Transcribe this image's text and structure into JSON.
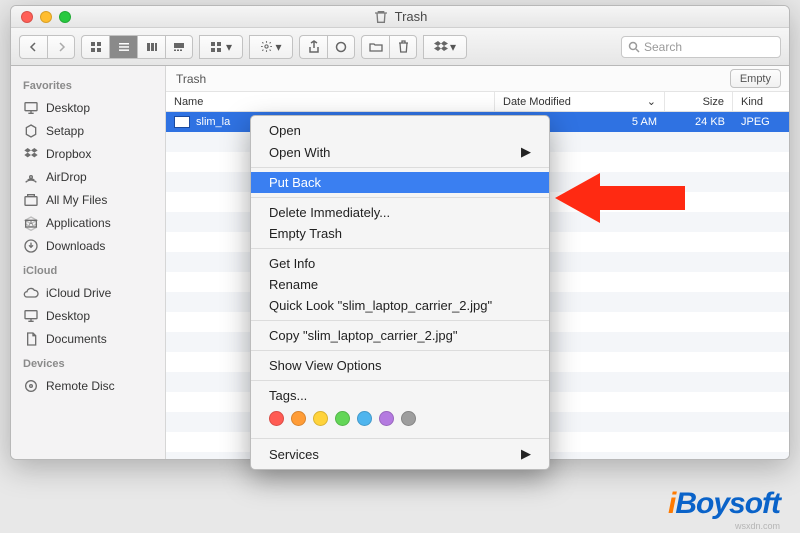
{
  "window": {
    "title": "Trash"
  },
  "toolbar": {
    "search_placeholder": "Search",
    "empty_label": "Empty"
  },
  "pathbar": {
    "location": "Trash"
  },
  "sidebar": {
    "sections": [
      {
        "title": "Favorites",
        "items": [
          {
            "label": "Desktop",
            "icon": "desktop"
          },
          {
            "label": "Setapp",
            "icon": "setapp"
          },
          {
            "label": "Dropbox",
            "icon": "dropbox"
          },
          {
            "label": "AirDrop",
            "icon": "airdrop"
          },
          {
            "label": "All My Files",
            "icon": "allfiles"
          },
          {
            "label": "Applications",
            "icon": "apps"
          },
          {
            "label": "Downloads",
            "icon": "downloads"
          }
        ]
      },
      {
        "title": "iCloud",
        "items": [
          {
            "label": "iCloud Drive",
            "icon": "icloud"
          },
          {
            "label": "Desktop",
            "icon": "desktop"
          },
          {
            "label": "Documents",
            "icon": "documents"
          }
        ]
      },
      {
        "title": "Devices",
        "items": [
          {
            "label": "Remote Disc",
            "icon": "disc"
          }
        ]
      }
    ]
  },
  "columns": {
    "name": "Name",
    "date": "Date Modified",
    "size": "Size",
    "kind": "Kind"
  },
  "rows": [
    {
      "name": "slim_la",
      "date": "5 AM",
      "size": "24 KB",
      "kind": "JPEG",
      "selected": true
    }
  ],
  "context_menu": {
    "groups": [
      [
        {
          "label": "Open"
        },
        {
          "label": "Open With",
          "submenu": true
        }
      ],
      [
        {
          "label": "Put Back",
          "selected": true
        }
      ],
      [
        {
          "label": "Delete Immediately..."
        },
        {
          "label": "Empty Trash"
        }
      ],
      [
        {
          "label": "Get Info"
        },
        {
          "label": "Rename"
        },
        {
          "label": "Quick Look \"slim_laptop_carrier_2.jpg\""
        }
      ],
      [
        {
          "label": "Copy \"slim_laptop_carrier_2.jpg\""
        }
      ],
      [
        {
          "label": "Show View Options"
        }
      ],
      [
        {
          "label": "Tags..."
        }
      ]
    ],
    "tag_colors": [
      "#ff5b53",
      "#ff9c36",
      "#ffd33b",
      "#63d657",
      "#4fb5ee",
      "#b47ae0",
      "#9e9e9e"
    ],
    "services": "Services"
  },
  "watermark": {
    "brand_i": "i",
    "brand_rest": "Boysoft",
    "sub": "wsxdn.com"
  }
}
